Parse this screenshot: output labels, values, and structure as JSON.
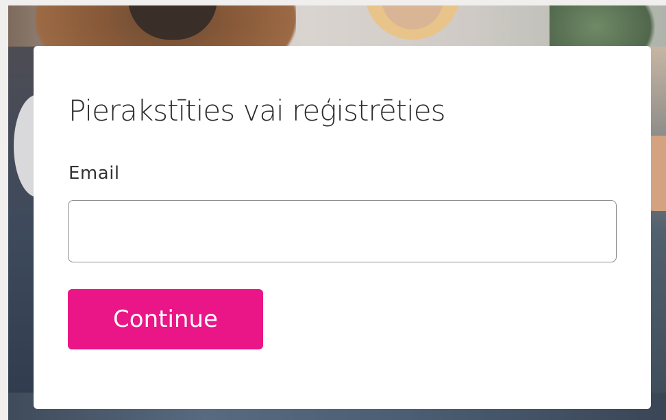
{
  "login": {
    "title": "Pierakstīties vai reģistrēties",
    "email_label": "Email",
    "email_value": "",
    "email_placeholder": "",
    "continue_label": "Continue"
  },
  "colors": {
    "accent": "#ea1587",
    "card_background": "#ffffff",
    "input_border": "#8b8b8b",
    "title_text": "#2b2b2b"
  }
}
